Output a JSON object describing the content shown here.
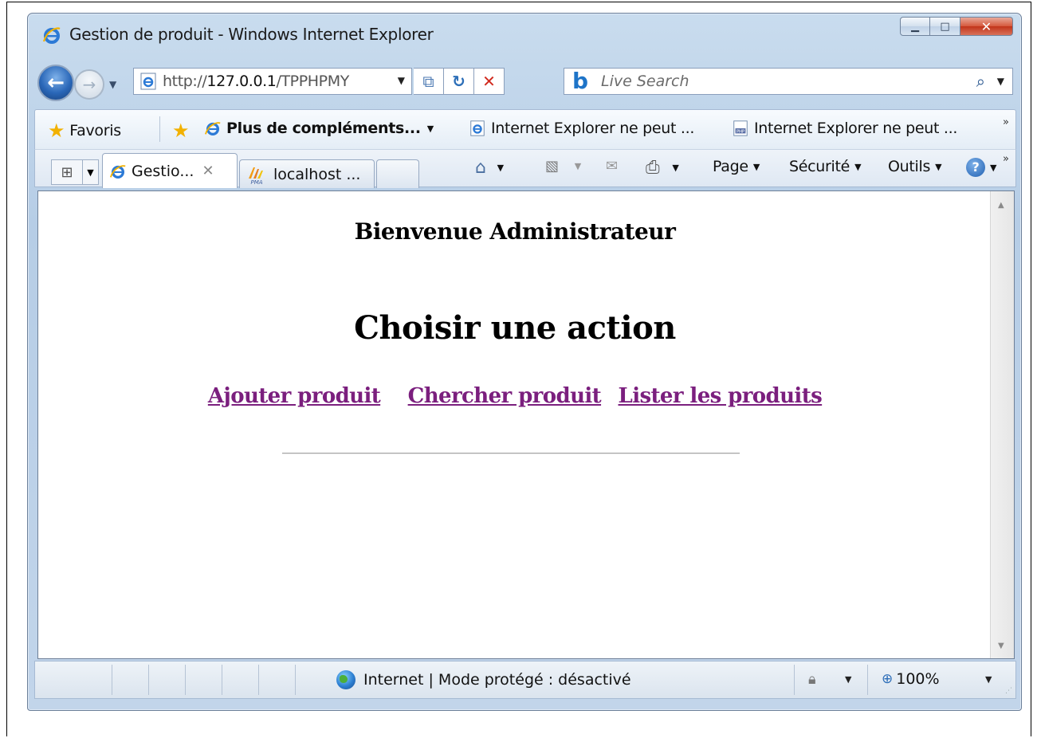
{
  "window": {
    "title": "Gestion de produit - Windows Internet Explorer"
  },
  "address": {
    "url_prefix": "http://",
    "url_host": "127.0.0.1",
    "url_path": "/TPPHPMY"
  },
  "search": {
    "placeholder": "Live Search"
  },
  "favorites": {
    "favoris_label": "Favoris",
    "more_addons_label": "Plus de compléments...",
    "link1_label": "Internet Explorer ne peut ...",
    "link2_label": "Internet Explorer ne peut ..."
  },
  "tabs": [
    {
      "label": "Gestio..."
    },
    {
      "label": "localhost ..."
    }
  ],
  "commands": {
    "page": "Page",
    "security": "Sécurité",
    "tools": "Outils"
  },
  "page": {
    "welcome": "Bienvenue Administrateur",
    "heading": "Choisir une action",
    "links": [
      "Ajouter produit",
      "Chercher produit",
      "Lister les produits"
    ]
  },
  "status": {
    "zone": "Internet | Mode protégé : désactivé",
    "zoom": "100%"
  },
  "colors": {
    "visited_link": "#7b1f7e",
    "title_accent": "#1e74c8"
  }
}
